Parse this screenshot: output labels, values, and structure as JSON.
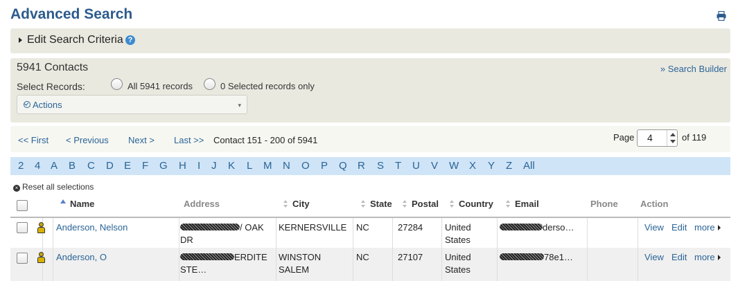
{
  "page": {
    "title": "Advanced Search",
    "print_icon": "print-icon"
  },
  "criteria": {
    "label": "Edit Search Criteria",
    "help_glyph": "?"
  },
  "summary": {
    "count": "5941 Contacts",
    "search_builder": "» Search Builder",
    "select_records_label": "Select Records:",
    "radio_all": "All 5941 records",
    "radio_selected": "0 Selected records only",
    "actions_label": "Actions",
    "actions_caret": "▾"
  },
  "pager": {
    "first": "<< First",
    "previous": "< Previous",
    "next": "Next >",
    "last": "Last >>",
    "range": "Contact 151 - 200 of 5941",
    "page_label": "Page",
    "page_value": "4",
    "of_label": "of 119"
  },
  "alpha": [
    "2",
    "4",
    "A",
    "B",
    "C",
    "D",
    "E",
    "F",
    "G",
    "H",
    "I",
    "J",
    "K",
    "L",
    "M",
    "N",
    "O",
    "P",
    "Q",
    "R",
    "S",
    "T",
    "U",
    "V",
    "W",
    "X",
    "Y",
    "Z",
    "All"
  ],
  "reset": {
    "glyph": "×",
    "label": "Reset all selections"
  },
  "table": {
    "headers": {
      "name": "Name",
      "address": "Address",
      "city": "City",
      "state": "State",
      "postal": "Postal",
      "country": "Country",
      "email": "Email",
      "phone": "Phone",
      "action": "Action"
    },
    "rows": [
      {
        "name": "Anderson, Nelson",
        "address_line1_tail": "/ OAK",
        "address_line2": "DR",
        "city_line1": "KERNERSVILLE",
        "city_line2": "",
        "state": "NC",
        "postal": "27284",
        "country_line1": "United",
        "country_line2": "States",
        "email_tail": "derso…",
        "phone": "",
        "view": "View",
        "edit": "Edit",
        "more": "more"
      },
      {
        "name": "Anderson, O",
        "address_line1_tail": "ERDITE",
        "address_line2": "STE…",
        "city_line1": "WINSTON",
        "city_line2": "SALEM",
        "state": "NC",
        "postal": "27107",
        "country_line1": "United",
        "country_line2": "States",
        "email_tail": "78e1…",
        "phone": "",
        "view": "View",
        "edit": "Edit",
        "more": "more"
      }
    ]
  }
}
